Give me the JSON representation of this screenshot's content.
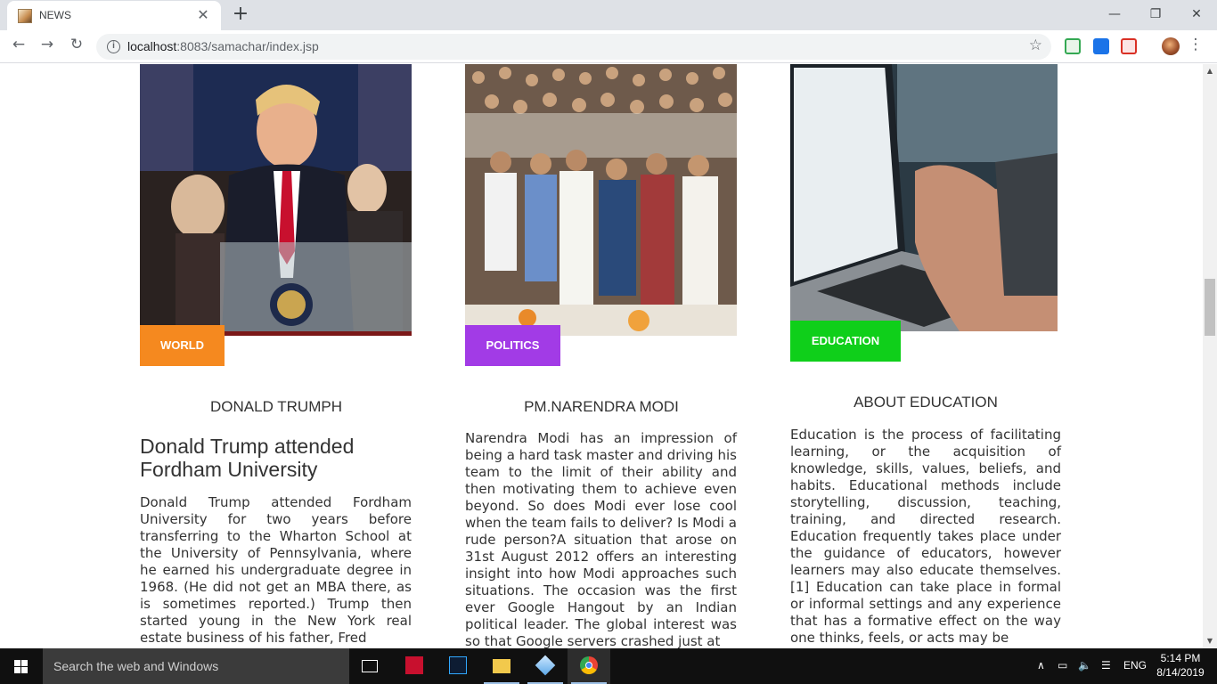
{
  "browser": {
    "tab_title": "NEWS",
    "close_tab": "✕",
    "new_tab": "+",
    "url_host": "localhost",
    "url_rest": ":8083/samachar/index.jsp",
    "window_controls": {
      "minimize": "—",
      "maximize": "❐",
      "close": "✕"
    }
  },
  "cards": [
    {
      "category": "WORLD",
      "badge_color": "#f5891f",
      "title": "DONALD TRUMPH",
      "headline": "Donald Trump attended Fordham University",
      "body": "Donald Trump attended Fordham University for two years before transferring to the Wharton School at the University of Pennsylvania, where he earned his undergraduate degree in 1968. (He did not get an MBA there, as is sometimes reported.) Trump then started young in the New York real estate business of his father, Fred"
    },
    {
      "category": "POLITICS",
      "badge_color": "#a23be6",
      "title": "PM.NARENDRA MODI",
      "body": "Narendra Modi has an impression of being a hard task master and driving his team to the limit of their ability and then motivating them to achieve even beyond. So does Modi ever lose cool when the team fails to deliver? Is Modi a rude person?A situation that arose on 31st August 2012 offers an interesting insight into how Modi approaches such situations. The occasion was the first ever Google Hangout by an Indian political leader. The global interest was so that Google servers crashed just at"
    },
    {
      "category": "EDUCATION",
      "badge_color": "#0fcf1a",
      "title": "ABOUT EDUCATION",
      "body": "Education is the process of facilitating learning, or the acquisition of knowledge, skills, values, beliefs, and habits. Educational methods include storytelling, discussion, teaching, training, and directed research. Education frequently takes place under the guidance of educators, however learners may also educate themselves.[1] Education can take place in formal or informal settings and any experience that has a formative effect on the way one thinks, feels, or acts may be"
    }
  ],
  "taskbar": {
    "search_placeholder": "Search the web and Windows",
    "language": "ENG",
    "time": "5:14 PM",
    "date": "8/14/2019"
  }
}
